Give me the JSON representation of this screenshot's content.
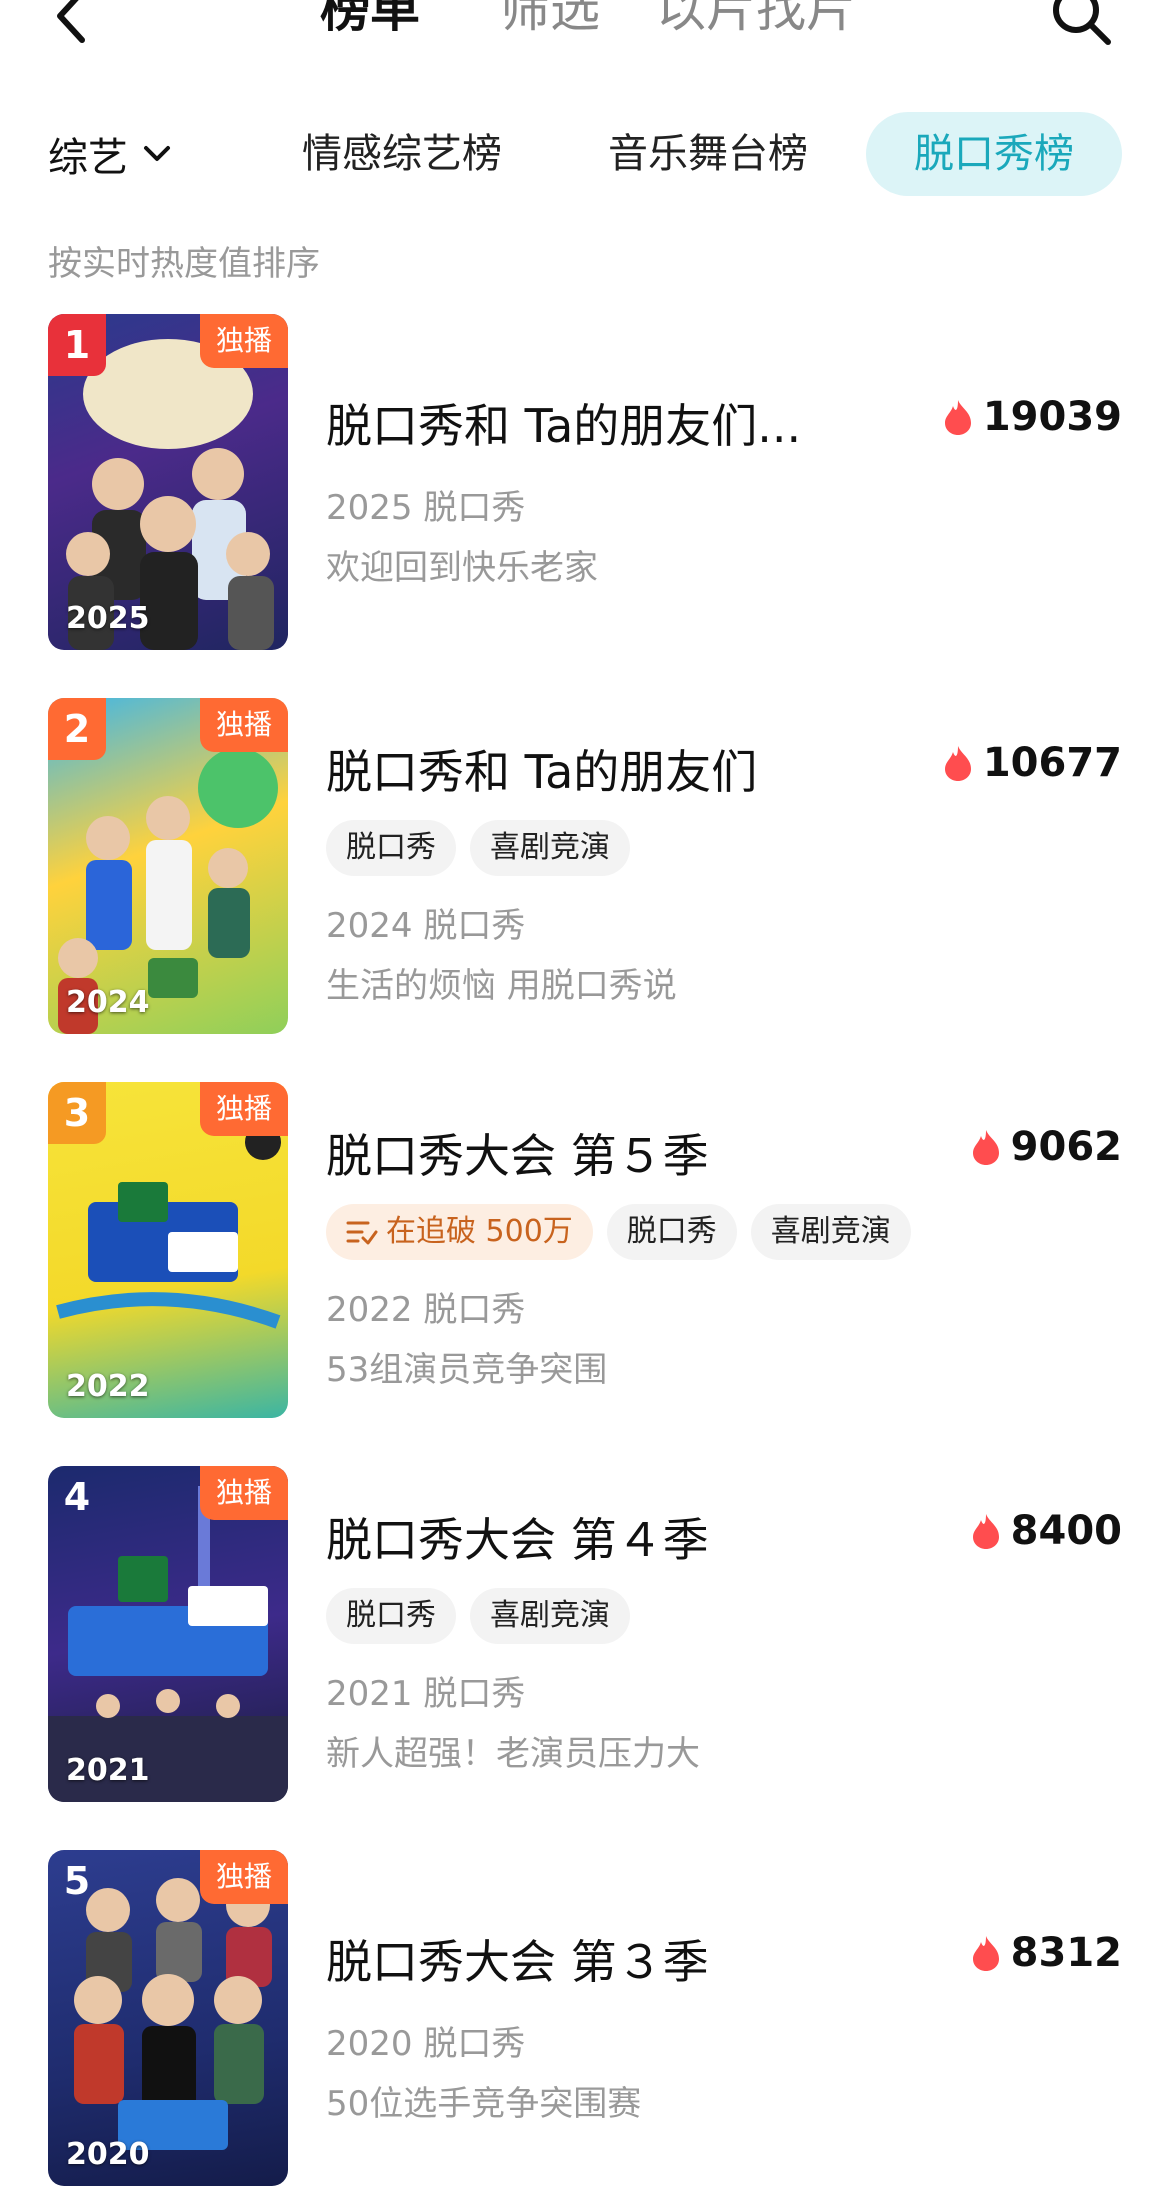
{
  "nav": {
    "tabs": [
      "榜单",
      "筛选",
      "以片找片"
    ]
  },
  "category": {
    "dropdown_label": "综艺",
    "tabs": [
      "情感综艺榜",
      "音乐舞台榜",
      "脱口秀榜"
    ]
  },
  "sort_note": "按实时热度值排序",
  "colors": {
    "accent": "#1aa8bb",
    "rank1": "#e8313a",
    "rank2": "#ff6a33",
    "rank3": "#f59a23",
    "flame": "#ff4d4f"
  },
  "items": [
    {
      "rank": "1",
      "badge": "独播",
      "poster_year": "2025",
      "title": "脱口秀和 Ta的朋友们...",
      "heat": "19039",
      "meta": "2025 脱口秀",
      "desc": "欢迎回到快乐老家"
    },
    {
      "rank": "2",
      "badge": "独播",
      "poster_year": "2024",
      "title": "脱口秀和 Ta的朋友们",
      "heat": "10677",
      "tags": [
        "脱口秀",
        "喜剧竞演"
      ],
      "meta": "2024 脱口秀",
      "desc": "生活的烦恼 用脱口秀说"
    },
    {
      "rank": "3",
      "badge": "独播",
      "poster_year": "2022",
      "title": "脱口秀大会 第５季",
      "heat": "9062",
      "chase_tag": "在追破 500万",
      "tags": [
        "脱口秀",
        "喜剧竞演"
      ],
      "meta": "2022 脱口秀",
      "desc": "53组演员竞争突围"
    },
    {
      "rank": "4",
      "badge": "独播",
      "poster_year": "2021",
      "title": "脱口秀大会 第４季",
      "heat": "8400",
      "tags": [
        "脱口秀",
        "喜剧竞演"
      ],
      "meta": "2021 脱口秀",
      "desc": "新人超强！老演员压力大"
    },
    {
      "rank": "5",
      "badge": "独播",
      "poster_year": "2020",
      "title": "脱口秀大会 第３季",
      "heat": "8312",
      "meta": "2020 脱口秀",
      "desc": "50位选手竞争突围赛"
    }
  ]
}
